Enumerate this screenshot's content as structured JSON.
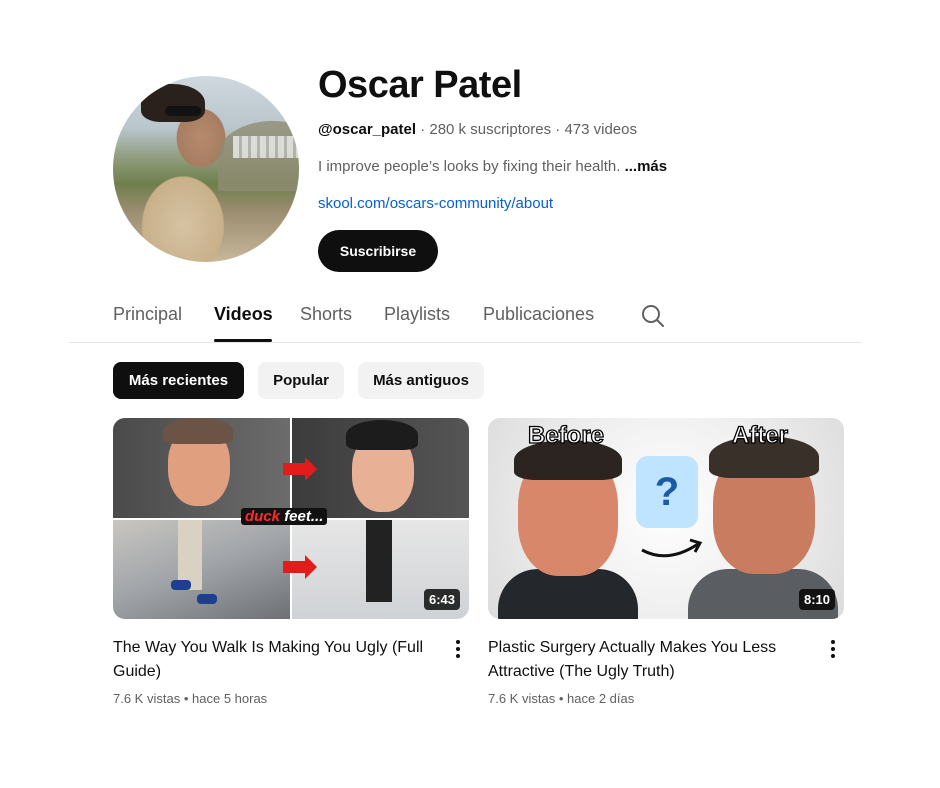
{
  "channel": {
    "name": "Oscar Patel",
    "handle": "@oscar_patel",
    "subscribers": "280 k suscriptores",
    "videos_count": "473 videos",
    "separator": "·",
    "description": "I improve people’s looks by fixing their health.",
    "more_label": "...más",
    "link": "skool.com/oscars-community/about",
    "subscribe_label": "Suscribirse"
  },
  "tabs": [
    {
      "label": "Principal",
      "active": false
    },
    {
      "label": "Videos",
      "active": true
    },
    {
      "label": "Shorts",
      "active": false
    },
    {
      "label": "Playlists",
      "active": false
    },
    {
      "label": "Publicaciones",
      "active": false
    }
  ],
  "filters": [
    {
      "label": "Más recientes",
      "selected": true
    },
    {
      "label": "Popular",
      "selected": false
    },
    {
      "label": "Más antiguos",
      "selected": false
    }
  ],
  "videos": [
    {
      "title": "The Way You Walk Is Making You Ugly (Full Guide)",
      "views": "7.6 K vistas",
      "age": "hace 5 horas",
      "duration": "6:43",
      "overlay_red": "duck",
      "overlay_white": "feet..."
    },
    {
      "title": "Plastic Surgery Actually Makes You Less Attractive (The Ugly Truth)",
      "views": "7.6 K vistas",
      "age": "hace 2 días",
      "duration": "8:10",
      "before_label": "Before",
      "after_label": "After",
      "question": "?"
    }
  ],
  "stat_separator": "•",
  "colors": {
    "link": "#065fd4",
    "text": "#0f0f0f",
    "secondary": "#606060",
    "accent_red": "#e31b1b"
  },
  "icons": [
    "search-icon",
    "more-vert-icon"
  ]
}
